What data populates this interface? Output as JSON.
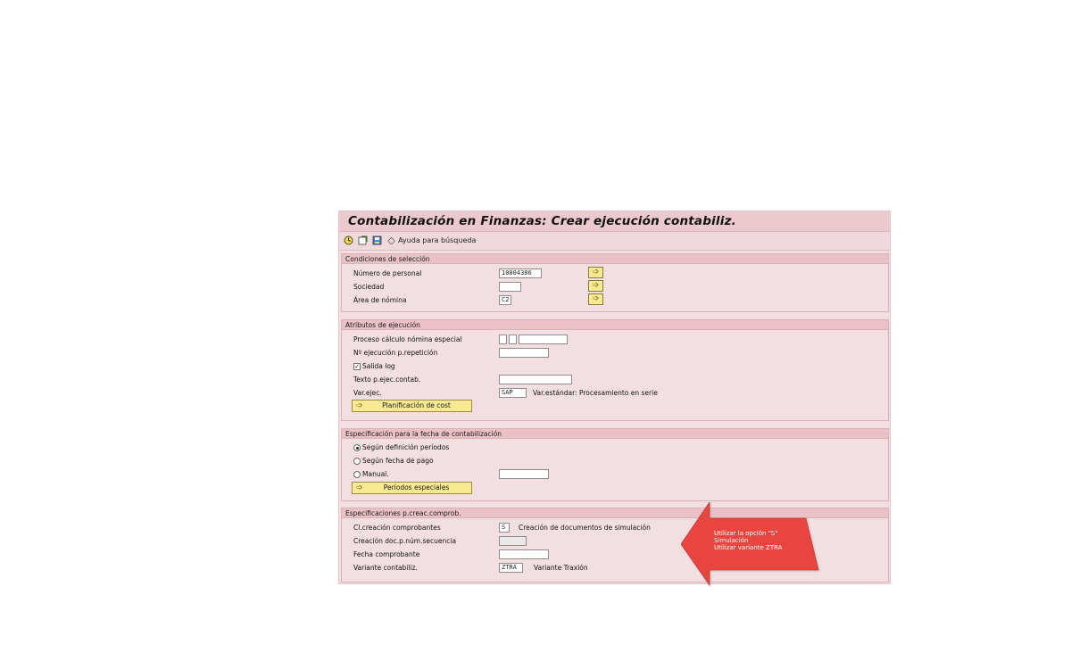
{
  "window": {
    "title": "Contabilización en Finanzas: Crear ejecución contabiliz."
  },
  "toolbar": {
    "execute_icon": "execute-clock-icon",
    "variant_icon": "get-variant-icon",
    "save_icon": "save-variant-icon",
    "help_label": "Ayuda para búsqueda"
  },
  "selection": {
    "header": "Condiciones de selección",
    "personal_label": "Número de personal",
    "personal_value": "10004386",
    "sociedad_label": "Sociedad",
    "sociedad_value": "",
    "area_label": "Área de nómina",
    "area_value": "C2"
  },
  "attributes": {
    "header": "Atributos de ejecución",
    "proceso_label": "Proceso cálculo nómina especial",
    "repeticion_label": "Nº ejecución p.repetición",
    "salida_log_label": "Salida log",
    "salida_log_checked": true,
    "texto_label": "Texto p.ejec.contab.",
    "varejec_label": "Var.ejec.",
    "varejec_value": "SAP",
    "varejec_desc": "Var.estándar: Procesamiento en serie",
    "planificacion_button": "Planificación de cost"
  },
  "posting_date": {
    "header": "Especificación para la fecha de contabilización",
    "option1": "Según definición períodos",
    "option2": "Según fecha de pago",
    "option3": "Manual.",
    "selected": "option1",
    "periodos_button": "Períodos especiales"
  },
  "documents": {
    "header": "Especificaciones p.creac.comprob.",
    "clase_label": "Cl.creación comprobantes",
    "clase_value": "S",
    "clase_desc": "Creación de documentos de simulación",
    "secuencia_label": "Creación doc.p.núm.secuencia",
    "fecha_label": "Fecha comprobante",
    "variante_label": "Variante contabiliz.",
    "variante_value": "ZTRA",
    "variante_desc": "Variante Traxión"
  },
  "callout": {
    "line1": "Utilizar  la opción \"S\"",
    "line2": "Simulación",
    "line3": "Utilizar variante ZTRA",
    "color": "#e8453f"
  }
}
